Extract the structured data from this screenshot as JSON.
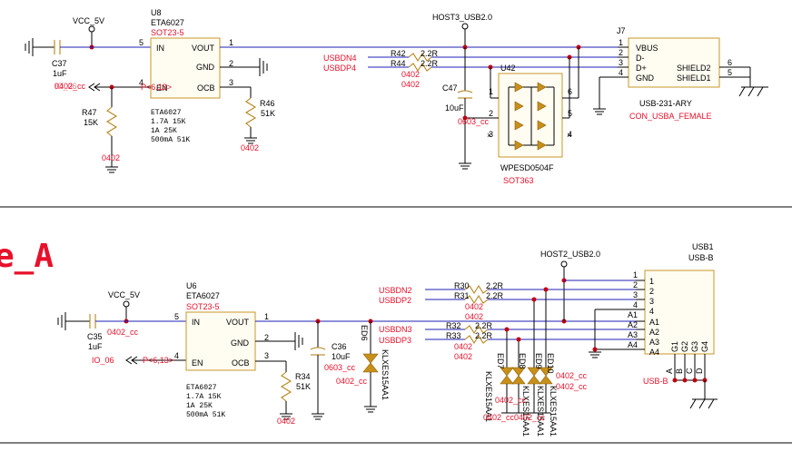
{
  "top": {
    "vcc_label": "VCC_5V",
    "c37": {
      "ref": "C37",
      "val": "1uF",
      "pkg": "0402_cc"
    },
    "io_label": "IO_06",
    "u8": {
      "ref": "U8",
      "part": "ETA6027",
      "pkg": "SOT23-5",
      "pins": {
        "in": "IN",
        "vout": "VOUT",
        "gnd": "GND",
        "en": "EN",
        "ocb": "OCB"
      },
      "pin_nums": [
        "5",
        "1",
        "2",
        "4",
        "3"
      ],
      "body_name": "ETA6027",
      "table": [
        "1.7A   15K",
        "1A     25K",
        "500mA  51K"
      ]
    },
    "en_ref": "P<6,13>",
    "r47": {
      "ref": "R47",
      "val": "15K",
      "pkg": "0402"
    },
    "r46": {
      "ref": "R46",
      "val": "51K",
      "pkg": "0402"
    },
    "host_label": "HOST3_USB2.0",
    "nets": [
      "USBDN4",
      "USBDP4"
    ],
    "r42": {
      "ref": "R42",
      "val": "2.2R"
    },
    "r44": {
      "ref": "R44",
      "val": "2.2R"
    },
    "r_pkg": [
      "0402",
      "0402"
    ],
    "c47": {
      "ref": "C47",
      "val": "10uF",
      "pkg": "0603_cc"
    },
    "u42": {
      "ref": "U42",
      "part": "WPESD0504F",
      "pkg": "SOT363",
      "pins": [
        "1",
        "2",
        "3",
        "4",
        "5",
        "6"
      ]
    },
    "j7": {
      "ref": "J7",
      "pins": [
        "VBUS",
        "D-",
        "D+",
        "GND"
      ],
      "shields": [
        "SHIELD2",
        "SHIELD1"
      ],
      "pin_nums": [
        "1",
        "2",
        "3",
        "4"
      ],
      "shield_nums": [
        "6",
        "5"
      ],
      "part": "USB-231-ARY",
      "value": "CON_USBA_FEMALE"
    }
  },
  "bottom": {
    "title_fragment": "e_A",
    "vcc_label": "VCC_5V",
    "c35": {
      "ref": "C35",
      "val": "1uF",
      "pkg": "0402_cc"
    },
    "io_label": "IO_06",
    "u6": {
      "ref": "U6",
      "part": "ETA6027",
      "pkg": "SOT23-5",
      "pins": {
        "in": "IN",
        "vout": "VOUT",
        "gnd": "GND",
        "en": "EN",
        "ocb": "OCB"
      },
      "pin_nums": [
        "5",
        "1",
        "2",
        "4",
        "3"
      ],
      "body_name": "ETA6027",
      "table": [
        "1.7A   15K",
        "1A     25K",
        "500mA  51K"
      ]
    },
    "en_ref": "P<6,13>",
    "r34": {
      "ref": "R34",
      "val": "51K",
      "pkg": "0402"
    },
    "c36": {
      "ref": "C36",
      "val": "10uF",
      "pkg": "0603_cc"
    },
    "ed6": {
      "ref": "ED6",
      "part": "KLXES15AA1",
      "pkg": "0402_cc"
    },
    "host_label": "HOST2_USB2.0",
    "nets": [
      "USBDN2",
      "USBDP2",
      "USBDN3",
      "USBDP3"
    ],
    "r30": {
      "ref": "R30",
      "val": "2.2R"
    },
    "r31": {
      "ref": "R31",
      "val": "2.2R"
    },
    "r32": {
      "ref": "R32",
      "val": "2.2R"
    },
    "r33": {
      "ref": "R33",
      "val": "2.2R"
    },
    "r_pkg": [
      "0402",
      "0402",
      "0402",
      "0402"
    ],
    "esd": [
      {
        "ref": "ED7",
        "part": "KLXES15AA1"
      },
      {
        "ref": "ED8",
        "part": "KLXES15AA1"
      },
      {
        "ref": "ED9",
        "part": "KLXES15AA1"
      },
      {
        "ref": "ED10",
        "part": "KLXES15AA1"
      }
    ],
    "esd_pkg": [
      "0402_cc",
      "0402_cc",
      "0402_cc",
      "0402_cc",
      "0402_cc"
    ],
    "usb1": {
      "ref": "USB1",
      "part": "USB-B",
      "pins": [
        "1",
        "2",
        "3",
        "4",
        "A1",
        "A2",
        "A3",
        "A4"
      ],
      "pin_nums": [
        "1",
        "2",
        "3",
        "4",
        "A1",
        "A2",
        "A3",
        "A4"
      ],
      "bottom_pins": [
        "G1",
        "G2",
        "G3",
        "G4"
      ],
      "bottom_nums": [
        "A",
        "B",
        "C",
        "D"
      ],
      "value": "USB-B"
    }
  }
}
